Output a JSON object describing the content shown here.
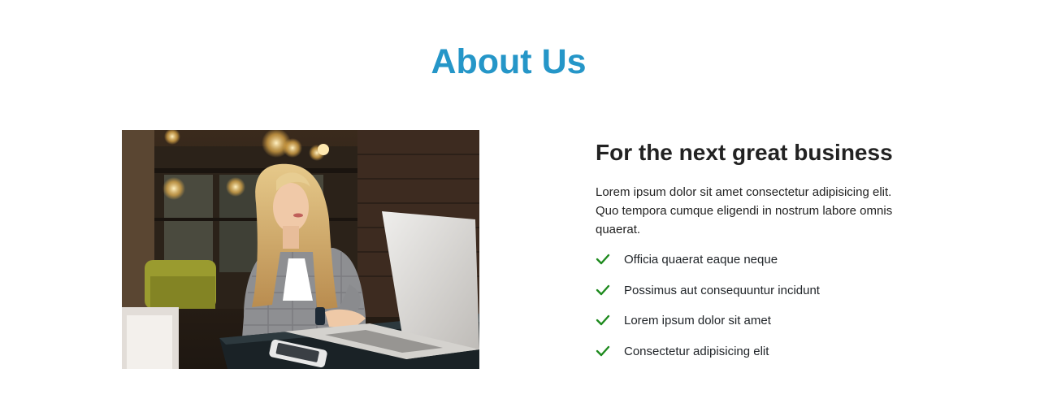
{
  "about": {
    "title": "About Us",
    "image_alt": "Woman working on a laptop in a cafe",
    "heading": "For the next great business",
    "description": "Lorem ipsum dolor sit amet consectetur adipisicing elit. Quo tempora cumque eligendi in nostrum labore omnis quaerat.",
    "features": [
      "Officia quaerat eaque neque",
      "Possimus aut consequuntur incidunt",
      "Lorem ipsum dolor sit amet",
      "Consectetur adipisicing elit"
    ],
    "icon": "check-icon",
    "colors": {
      "title": "#2596c8",
      "check": "#1e8a1e"
    }
  }
}
